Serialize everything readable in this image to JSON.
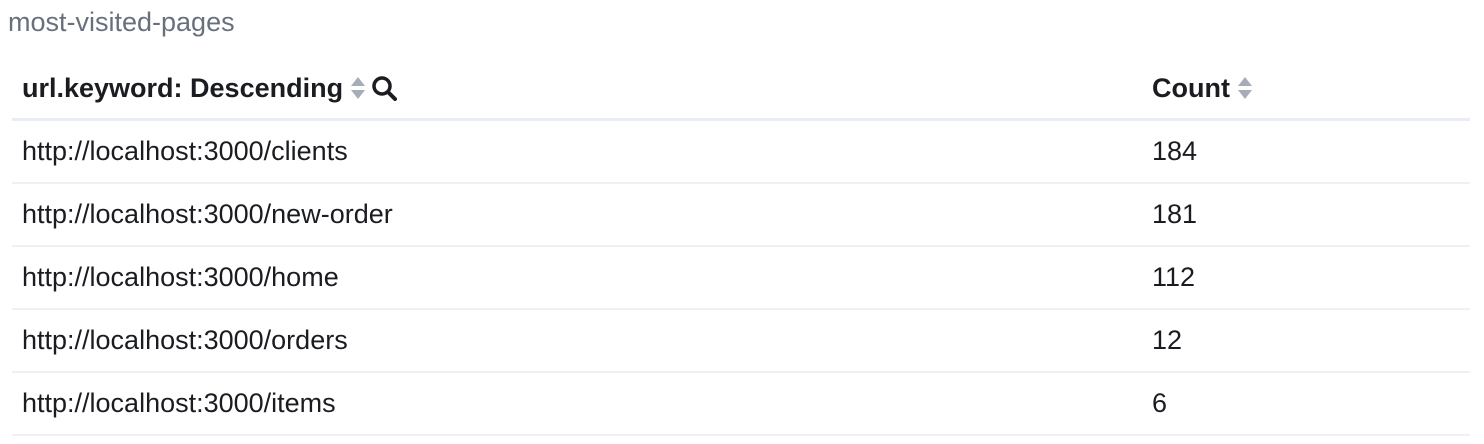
{
  "panel": {
    "title": "most-visited-pages"
  },
  "table": {
    "columns": [
      {
        "label": "url.keyword: Descending",
        "sort_icon": "sort-icon",
        "filter_icon": "search-icon"
      },
      {
        "label": "Count",
        "sort_icon": "sort-icon"
      }
    ],
    "rows": [
      {
        "url": "http://localhost:3000/clients",
        "count": "184"
      },
      {
        "url": "http://localhost:3000/new-order",
        "count": "181"
      },
      {
        "url": "http://localhost:3000/home",
        "count": "112"
      },
      {
        "url": "http://localhost:3000/orders",
        "count": "12"
      },
      {
        "url": "http://localhost:3000/items",
        "count": "6"
      }
    ]
  },
  "colors": {
    "title": "#69707d",
    "text": "#1a1c21",
    "sort_icon": "#a7adb8",
    "border": "#e9ecf0"
  }
}
